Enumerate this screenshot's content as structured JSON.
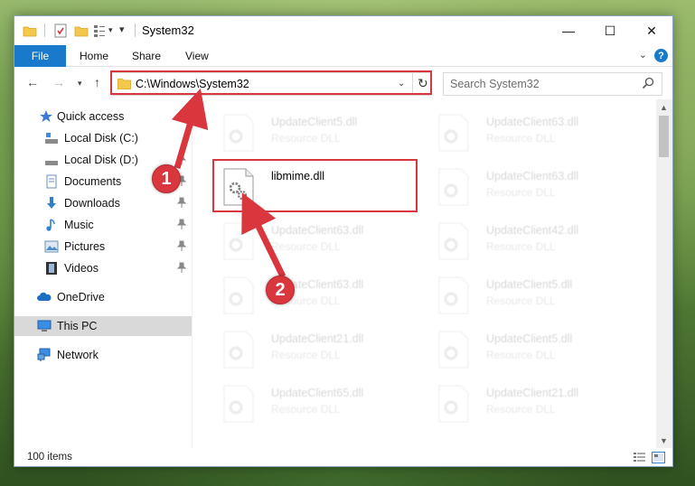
{
  "window": {
    "title": "System32",
    "controls": {
      "minimize": "—",
      "maximize": "☐",
      "close": "✕"
    }
  },
  "ribbon": {
    "tabs": [
      "File",
      "Home",
      "Share",
      "View"
    ],
    "help": "?"
  },
  "nav": {
    "address_path": "C:\\Windows\\System32",
    "search_placeholder": "Search System32"
  },
  "sidebar": {
    "items": [
      {
        "label": "Quick access",
        "icon": "star-icon"
      },
      {
        "label": "Local Disk (C:)",
        "icon": "drive-icon"
      },
      {
        "label": "Local Disk (D:)",
        "icon": "drive-icon"
      },
      {
        "label": "Documents",
        "icon": "documents-icon",
        "pinned": true
      },
      {
        "label": "Downloads",
        "icon": "downloads-icon",
        "pinned": true
      },
      {
        "label": "Music",
        "icon": "music-icon",
        "pinned": true
      },
      {
        "label": "Pictures",
        "icon": "pictures-icon",
        "pinned": true
      },
      {
        "label": "Videos",
        "icon": "videos-icon",
        "pinned": true
      },
      {
        "label": "OneDrive",
        "icon": "cloud-icon"
      },
      {
        "label": "This PC",
        "icon": "computer-icon",
        "selected": true
      },
      {
        "label": "Network",
        "icon": "network-icon"
      }
    ]
  },
  "files": {
    "left": [
      {
        "name": "UpdateClient5.dll",
        "type": "Resource DLL"
      },
      {
        "name": "libmime.dll",
        "type": ""
      },
      {
        "name": "UpdateClient63.dll",
        "type": "Resource DLL"
      },
      {
        "name": "UpdateClient63.dll",
        "type": "Resource DLL"
      },
      {
        "name": "UpdateClient21.dll",
        "type": "Resource DLL"
      },
      {
        "name": "UpdateClient65.dll",
        "type": "Resource DLL"
      }
    ],
    "right": [
      {
        "name": "UpdateClient63.dll",
        "type": "Resource DLL"
      },
      {
        "name": "UpdateClient63.dll",
        "type": "Resource DLL"
      },
      {
        "name": "UpdateClient42.dll",
        "type": "Resource DLL"
      },
      {
        "name": "UpdateClient5.dll",
        "type": "Resource DLL"
      },
      {
        "name": "UpdateClient5.dll",
        "type": "Resource DLL"
      },
      {
        "name": "UpdateClient21.dll",
        "type": "Resource DLL"
      }
    ]
  },
  "status": {
    "item_count": "100 items"
  },
  "annotations": {
    "step1": "1",
    "step2": "2",
    "color": "#d9363e"
  }
}
